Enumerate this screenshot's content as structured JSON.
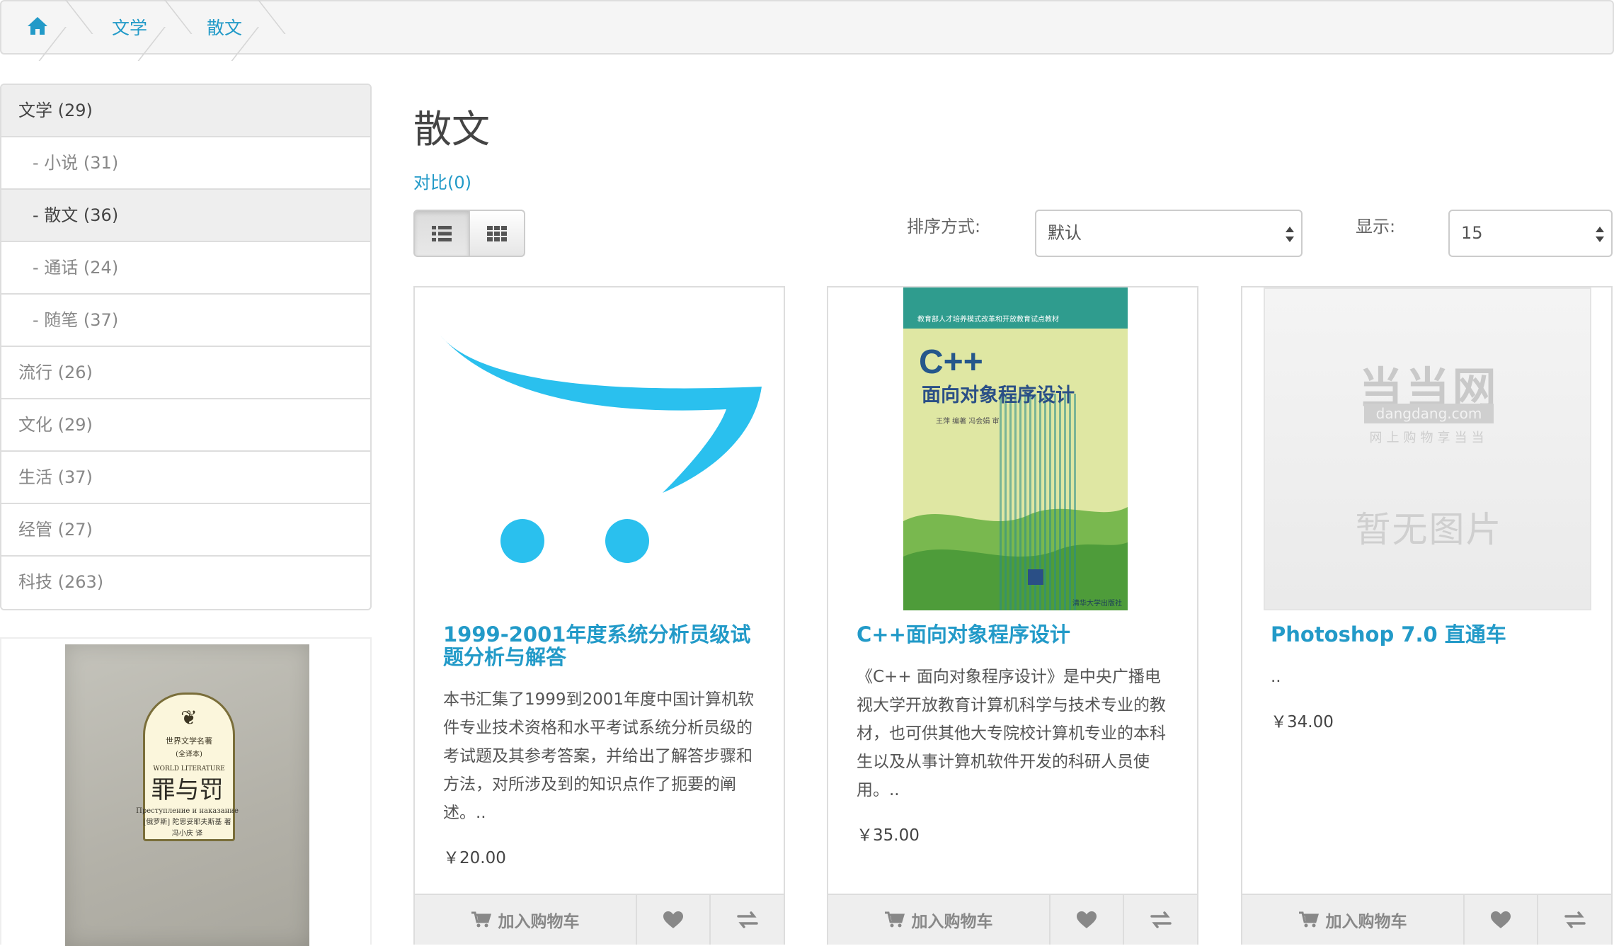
{
  "breadcrumb": {
    "items": [
      {
        "label": "文学"
      },
      {
        "label": "散文"
      }
    ]
  },
  "sidebar": {
    "categories": [
      {
        "label": "文学 (29)",
        "active": true,
        "sub": false
      },
      {
        "label": "- 小说 (31)",
        "active": false,
        "sub": true
      },
      {
        "label": "- 散文 (36)",
        "active": true,
        "sub": true
      },
      {
        "label": "- 通话 (24)",
        "active": false,
        "sub": true
      },
      {
        "label": "- 随笔 (37)",
        "active": false,
        "sub": true
      },
      {
        "label": "流行 (26)",
        "active": false,
        "sub": false
      },
      {
        "label": "文化 (29)",
        "active": false,
        "sub": false
      },
      {
        "label": "生活 (37)",
        "active": false,
        "sub": false
      },
      {
        "label": "经管 (27)",
        "active": false,
        "sub": false
      },
      {
        "label": "科技 (263)",
        "active": false,
        "sub": false
      }
    ],
    "banner": {
      "series_cn": "世界文学名著",
      "series_note": "(全译本)",
      "series_en": "WORLD LITERATURE",
      "title": "罪与罚",
      "subtitle_ru": "Преступление и наказание",
      "author": "[俄罗斯] 陀思妥耶夫斯基 著",
      "translator": "冯小庆 译"
    }
  },
  "main": {
    "title": "散文",
    "compare_link": "对比(0)",
    "sort_label": "排序方式:",
    "sort_value": "默认",
    "limit_label": "显示:",
    "limit_value": "15"
  },
  "products": [
    {
      "name": "1999-2001年度系统分析员级试题分析与解答",
      "description": "本书汇集了1999到2001年度中国计算机软件专业技术资格和水平考试系统分析员级的考试题及其参考答案，并给出了解答步骤和方法，对所涉及到的知识点作了扼要的阐述。..",
      "price": "￥20.00",
      "cart_label": "加入购物车"
    },
    {
      "name": "C++面向对象程序设计",
      "description": "《C++ 面向对象程序设计》是中央广播电视大学开放教育计算机科学与技术专业的教材，也可供其他大专院校计算机专业的本科生以及从事计算机软件开发的科研人员使用。..",
      "price": "￥35.00",
      "cart_label": "加入购物车",
      "cover": {
        "series": "教育部人才培养模式改革和开放教育试点教材",
        "logo": "C++",
        "title": "面向对象程序设计",
        "author": "王萍 编著   冯会娟 审",
        "publisher": "清华大学出版社"
      }
    },
    {
      "name": "Photoshop 7.0 直通车",
      "description": "..",
      "price": "￥34.00",
      "cart_label": "加入购物车",
      "placeholder": {
        "brand": "当当网",
        "domain": "dangdang.com",
        "tagline": "网上购物享当当",
        "message": "暂无图片"
      }
    }
  ],
  "colors": {
    "link": "#229ac8",
    "cart_blue": "#2ac0ee"
  }
}
